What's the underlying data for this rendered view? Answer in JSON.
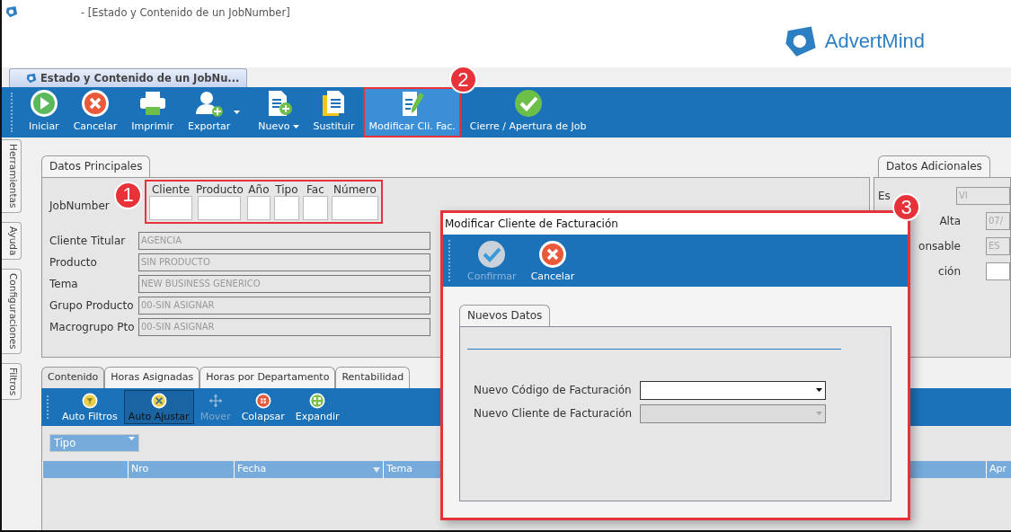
{
  "window": {
    "title": "- [Estado y Contenido de un JobNumber]",
    "brand": "AdvertMind"
  },
  "document_tab": {
    "label": "Estado y Contenido de un JobNu...",
    "selected": true
  },
  "toolbar": [
    {
      "label": "Iniciar",
      "kind": "play",
      "dropdown": false,
      "selected": false
    },
    {
      "label": "Cancelar",
      "kind": "cancel",
      "dropdown": false,
      "selected": false
    },
    {
      "label": "Imprimir",
      "kind": "print",
      "dropdown": false,
      "selected": false
    },
    {
      "label": "Exportar",
      "kind": "export",
      "dropdown": true,
      "selected": false
    },
    {
      "label": "Nuevo",
      "kind": "new",
      "dropdown": true,
      "selected": false
    },
    {
      "label": "Sustituir",
      "kind": "replace",
      "dropdown": false,
      "selected": false
    },
    {
      "label": "Modificar Cli. Fac.",
      "kind": "edit",
      "dropdown": false,
      "selected": true,
      "annotation": "2"
    },
    {
      "label": "Cierre / Apertura de Job",
      "kind": "check",
      "dropdown": false,
      "selected": false
    }
  ],
  "side_tabs": [
    "Herramientas",
    "Ayuda",
    "Configuraciones",
    "Filtros"
  ],
  "datos_principales": {
    "tab": "Datos Principales",
    "jobnumber_label": "JobNumber",
    "annotation": "1",
    "jobnumber_parts": [
      "Cliente",
      "Producto",
      "Año",
      "Tipo",
      "Fac",
      "Número"
    ],
    "fields": [
      {
        "label": "Cliente Titular",
        "value": "AGENCIA"
      },
      {
        "label": "Producto",
        "value": "SIN PRODUCTO"
      },
      {
        "label": "Tema",
        "value": "NEW BUSINESS GENERICO"
      },
      {
        "label": "Grupo Producto",
        "value": "00-SIN ASIGNAR"
      },
      {
        "label": "Macrogrupo Pto",
        "value": "00-SIN ASIGNAR"
      }
    ]
  },
  "datos_adicionales": {
    "tab": "Datos Adicionales",
    "fields": [
      {
        "label": "Es",
        "value": "VI"
      },
      {
        "label": "Alta",
        "value": "07/"
      },
      {
        "label": "onsable",
        "value": "ES"
      },
      {
        "label": "ción"
      }
    ]
  },
  "content_tabs": [
    {
      "label": "Contenido",
      "selected": true
    },
    {
      "label": "Horas Asignadas",
      "selected": false
    },
    {
      "label": "Horas por Departamento",
      "selected": false
    },
    {
      "label": "Rentabilidad",
      "selected": false
    }
  ],
  "content_toolbar": [
    {
      "label": "Auto Filtros",
      "kind": "filter",
      "selected": false,
      "disabled": false
    },
    {
      "label": "Auto Ajustar",
      "kind": "fit",
      "selected": true,
      "disabled": false
    },
    {
      "label": "Mover",
      "kind": "move",
      "selected": false,
      "disabled": true
    },
    {
      "label": "Colapsar",
      "kind": "collapse",
      "selected": false,
      "disabled": false
    },
    {
      "label": "Expandir",
      "kind": "expand",
      "selected": false,
      "disabled": false
    }
  ],
  "group_chip": "Tipo",
  "grid_columns": [
    {
      "label": "Nro",
      "sorted": false
    },
    {
      "label": "Fecha",
      "sorted": true
    },
    {
      "label": "Tema",
      "sorted": false
    },
    {
      "label": "Apr",
      "sorted": false
    }
  ],
  "dialog": {
    "title": "Modificar Cliente de Facturación",
    "annotation": "3",
    "toolbar": [
      {
        "label": "Confirmar",
        "kind": "confirm",
        "disabled": true
      },
      {
        "label": "Cancelar",
        "kind": "cancel",
        "disabled": false
      }
    ],
    "tab": "Nuevos Datos",
    "fields": [
      {
        "label": "Nuevo Código de Facturación",
        "disabled": false
      },
      {
        "label": "Nuevo Cliente de Facturación",
        "disabled": true
      }
    ]
  }
}
